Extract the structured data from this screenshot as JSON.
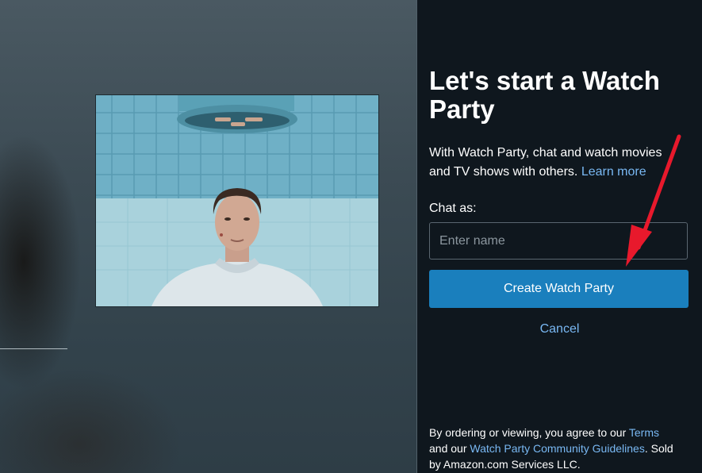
{
  "panel": {
    "title": "Let's start a Watch Party",
    "description": "With Watch Party, chat and watch movies and TV shows with others.",
    "description_line1": "With Watch Party, chat and watch movies",
    "description_line2": "and TV shows with others.",
    "learn_more": "Learn more",
    "chat_as_label": "Chat as:",
    "name_placeholder": "Enter name",
    "name_value": "",
    "create_button": "Create Watch Party",
    "cancel": "Cancel",
    "legal": {
      "line1_prefix": "By ordering or viewing, you agree to our",
      "terms_link": "Terms",
      "line2_prefix": "and our",
      "guidelines_link": "Watch Party Community Guidelines",
      "line2_suffix": ". Sold",
      "line3": "by Amazon.com Services LLC."
    }
  },
  "colors": {
    "panel_bg": "#0f171e",
    "button_bg": "#1a7fbd",
    "link": "#79b8f3",
    "annotation_arrow": "#e8192c"
  }
}
